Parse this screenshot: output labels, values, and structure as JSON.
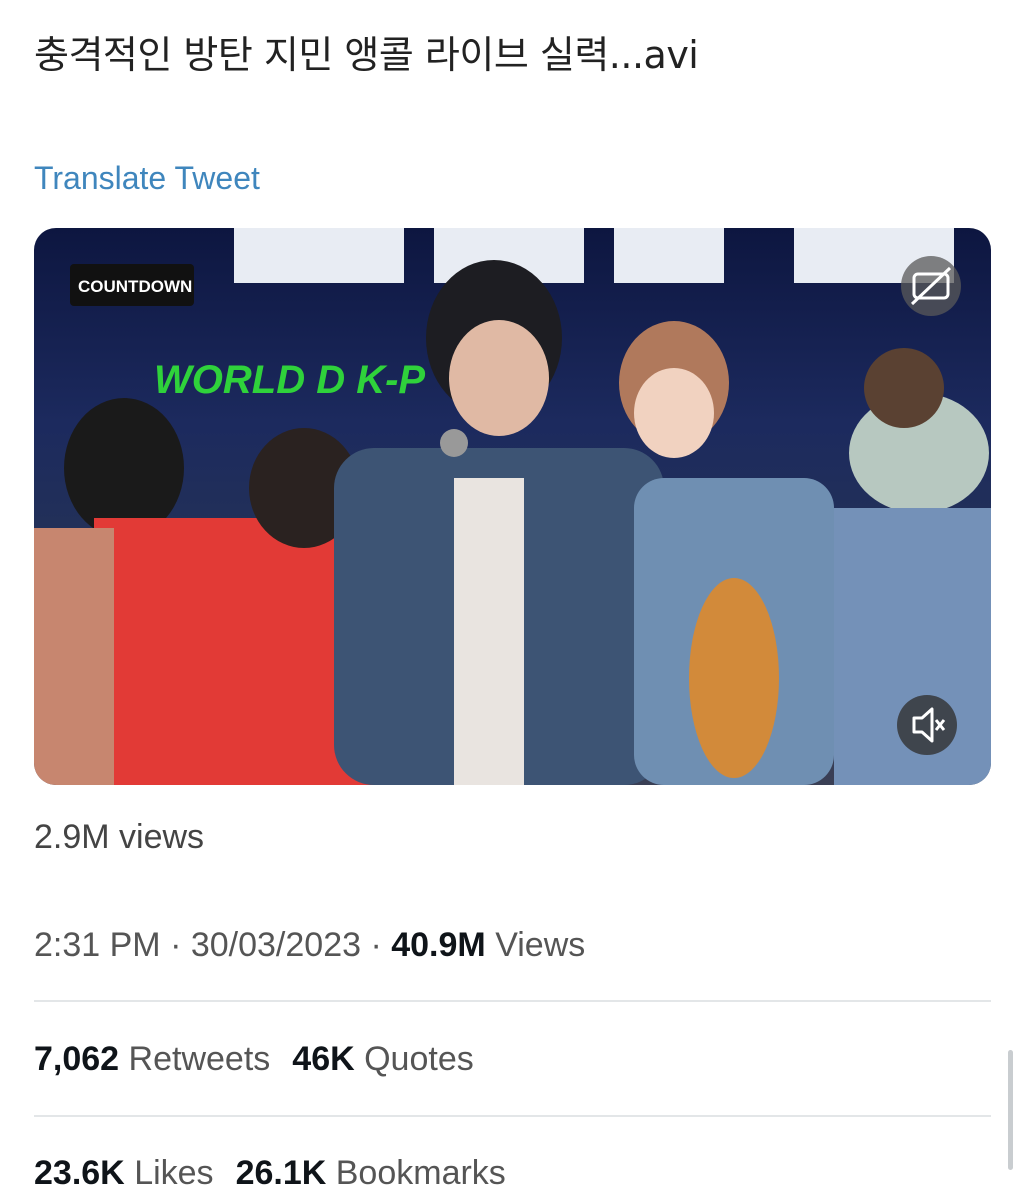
{
  "tweet": {
    "text": "충격적인 방탄 지민 앵콜 라이브 실력...avi",
    "translate_label": "Translate Tweet"
  },
  "media": {
    "logo_text": "COUNTDOWN",
    "banner_text": "WORLD    D   K-P",
    "cc_icon": "closed-captions-icon",
    "mute_icon": "muted-speaker-icon"
  },
  "video_views": "2.9M views",
  "meta": {
    "time": "2:31 PM",
    "sep1": " · ",
    "date": "30/03/2023",
    "sep2": " · ",
    "views_count": "40.9M",
    "views_label": "Views"
  },
  "stats": {
    "retweets_count": "7,062",
    "retweets_label": "Retweets",
    "quotes_count": "46K",
    "quotes_label": "Quotes",
    "likes_count": "23.6K",
    "likes_label": "Likes",
    "bookmarks_count": "26.1K",
    "bookmarks_label": "Bookmarks"
  },
  "colors": {
    "link": "#3f86bd",
    "divider": "#e3e6e8"
  }
}
